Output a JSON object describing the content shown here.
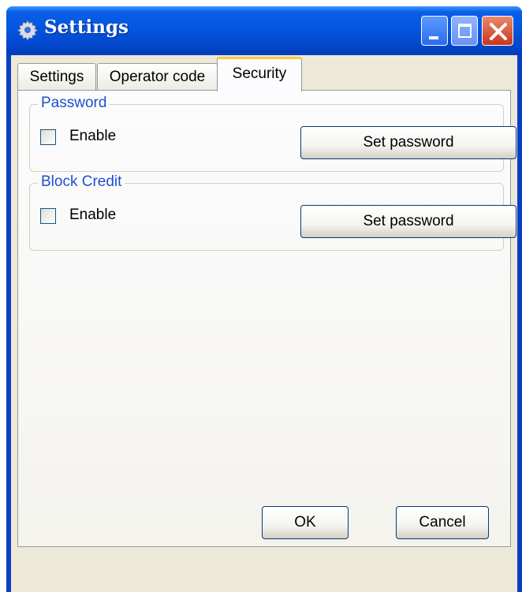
{
  "window": {
    "title": "Settings",
    "title_icon": "gear-icon",
    "controls": [
      "minimize-icon",
      "maximize-icon",
      "close-icon"
    ]
  },
  "tabs": [
    {
      "label": "Settings",
      "active": false
    },
    {
      "label": "Operator code",
      "active": false
    },
    {
      "label": "Security",
      "active": true
    }
  ],
  "password": {
    "legend": "Password",
    "enable_label": "Enable",
    "enabled": false,
    "button_label": "Set password"
  },
  "block_credit": {
    "legend": "Block Credit",
    "enable_label": "Enable",
    "enabled": false,
    "button_label": "Set password"
  },
  "footer": {
    "ok_label": "OK",
    "cancel_label": "Cancel"
  },
  "colors": {
    "titlebar": "#0356df",
    "dialog_bg": "#ece9d8",
    "group_legend": "#1f4fd2",
    "active_tab_accent": "#ffc83c"
  }
}
